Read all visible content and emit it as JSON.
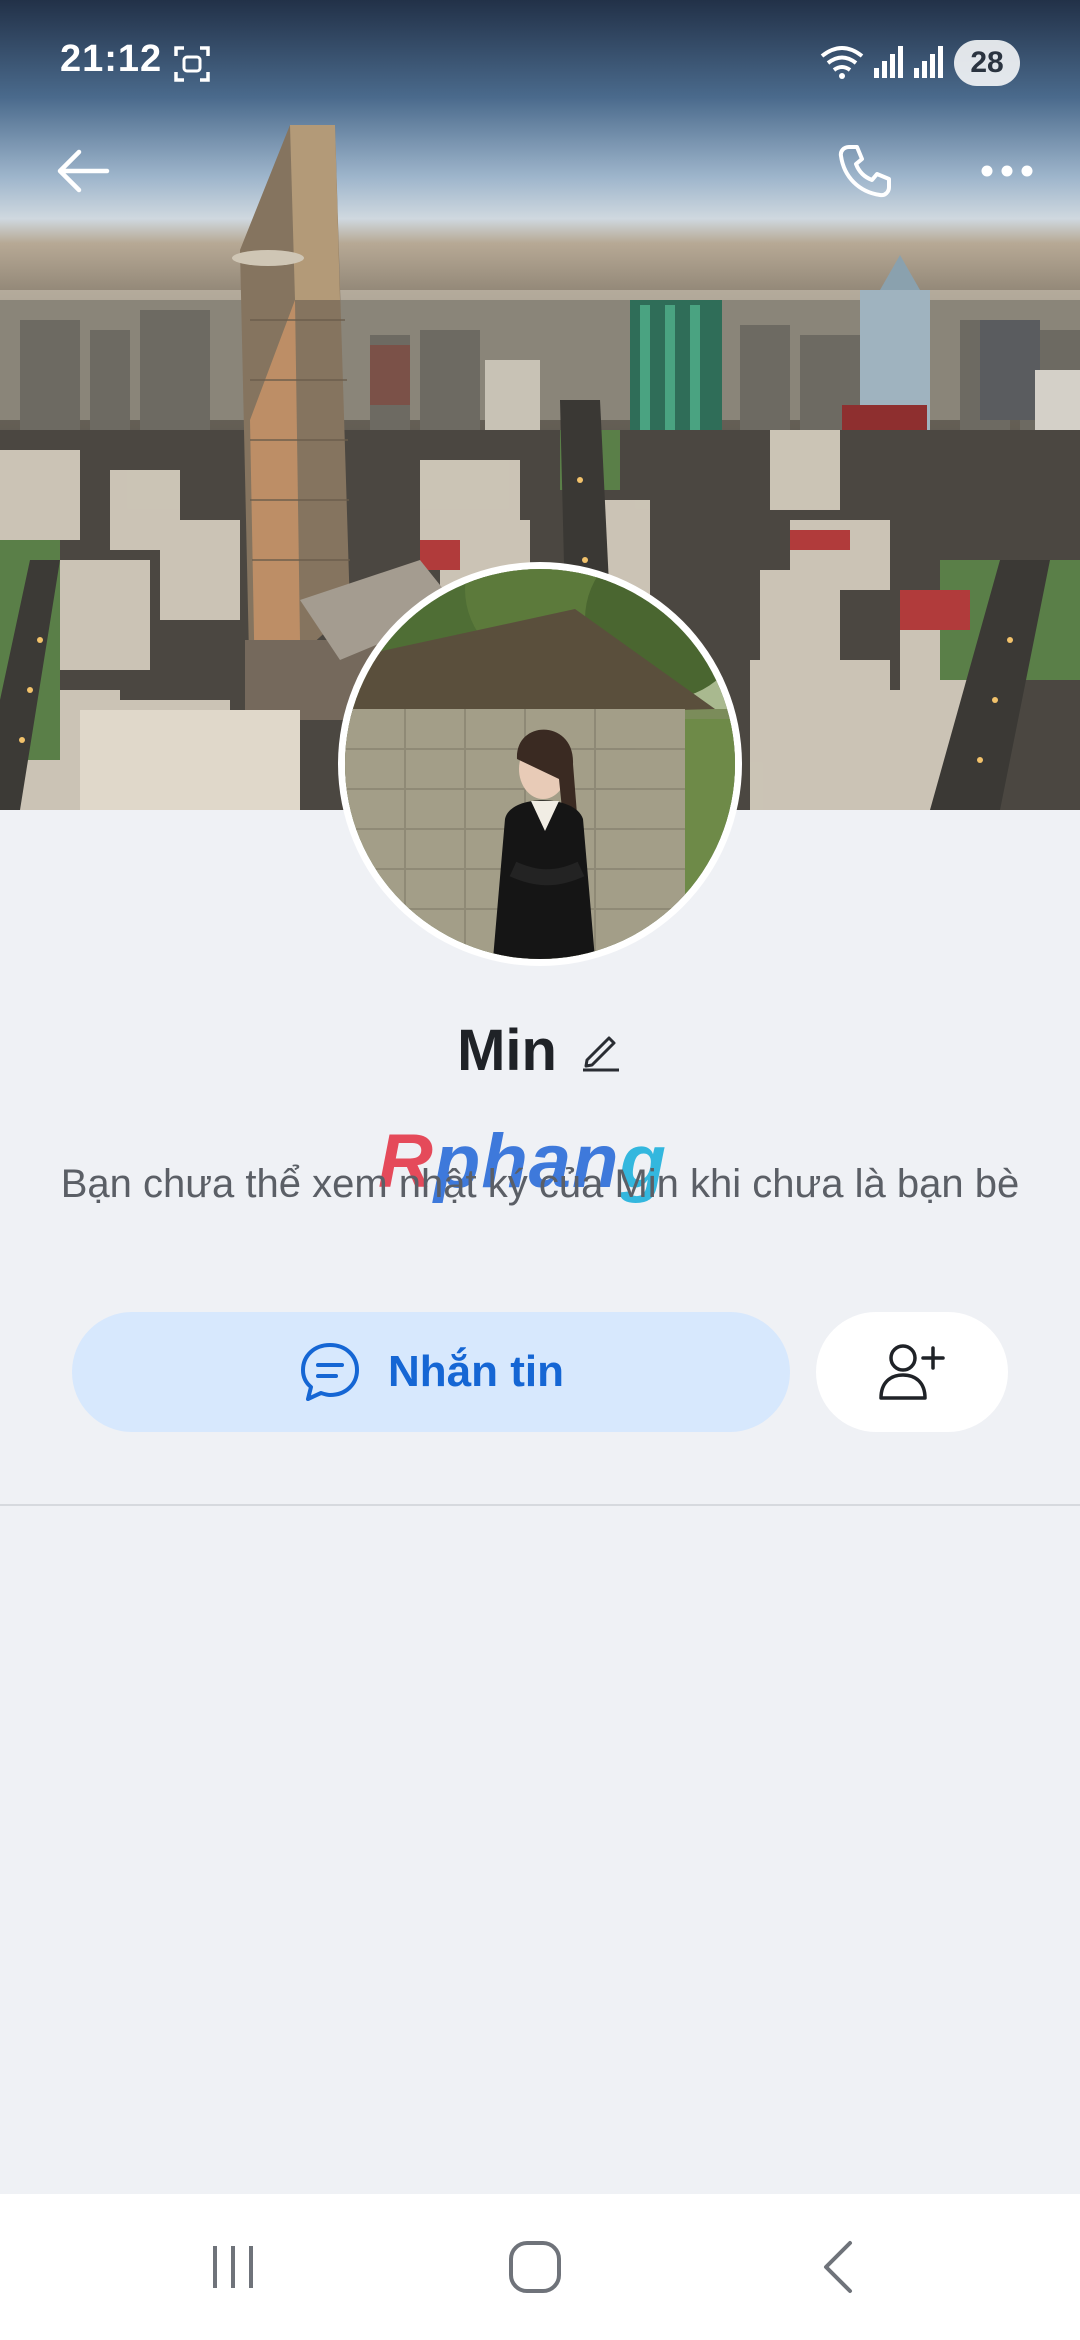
{
  "status_bar": {
    "time": "21:12",
    "battery_level": "28",
    "icons": [
      "screen-record-icon",
      "wifi-icon",
      "signal-icon",
      "signal-icon"
    ]
  },
  "header": {
    "back_icon": "arrow-left-icon",
    "call_icon": "phone-icon",
    "more_icon": "more-horizontal-icon"
  },
  "profile": {
    "name": "Min",
    "edit_icon": "pencil-icon",
    "privacy_note": "Bạn chưa thể xem nhật ký của Min khi chưa là bạn bè"
  },
  "watermark": {
    "part1": "R",
    "part2": "phan",
    "part3": "g"
  },
  "actions": {
    "message_label": "Nhắn tin",
    "message_icon": "chat-bubble-icon",
    "add_friend_icon": "user-plus-icon"
  },
  "colors": {
    "accent": "#1566d4",
    "message_button_bg": "#d7e8fd",
    "page_bg": "#eff1f5"
  },
  "system_nav": {
    "icons": [
      "recents-icon",
      "home-icon",
      "back-icon"
    ]
  }
}
